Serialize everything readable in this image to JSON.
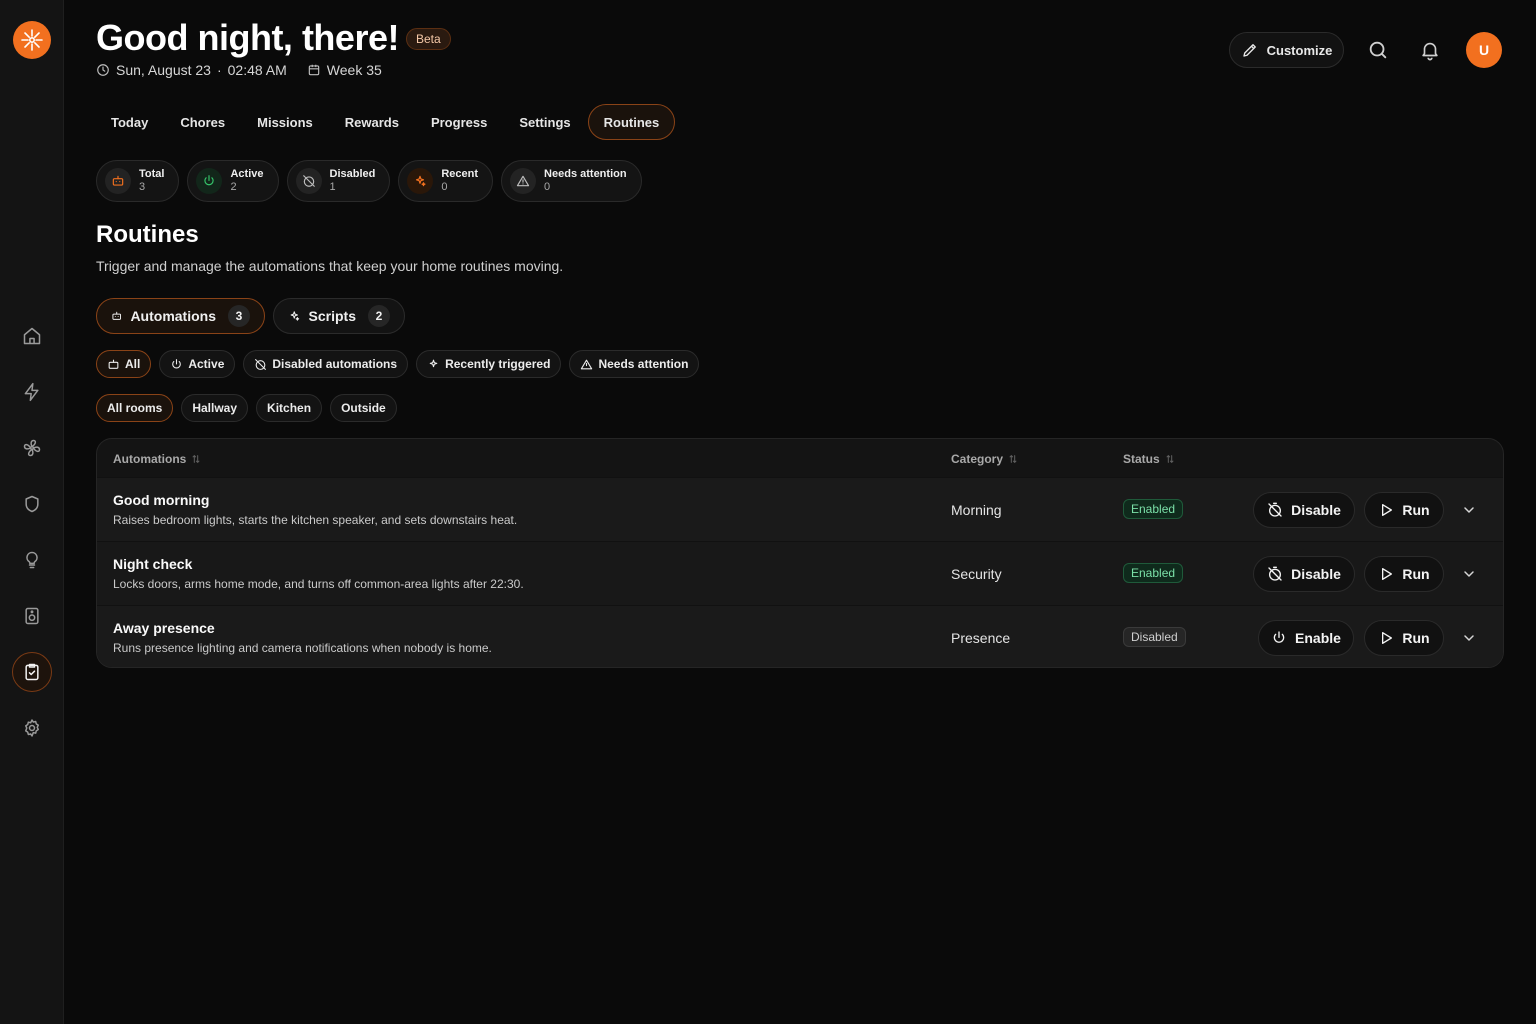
{
  "header": {
    "greeting": "Good night, there!",
    "badge": "Beta",
    "date": "Sun, August 23",
    "separator": "·",
    "time": "02:48 AM",
    "week": "Week 35",
    "customize_label": "Customize",
    "avatar_initial": "U"
  },
  "tabs": [
    "Today",
    "Chores",
    "Missions",
    "Rewards",
    "Progress",
    "Settings",
    "Routines"
  ],
  "stats": [
    {
      "label": "Total",
      "value": "3",
      "icon": "robot-icon",
      "color": "#f2701f"
    },
    {
      "label": "Active",
      "value": "2",
      "icon": "power-icon",
      "color": "#35c46a"
    },
    {
      "label": "Disabled",
      "value": "1",
      "icon": "timer-off-icon",
      "color": "#bdbdbd"
    },
    {
      "label": "Recent",
      "value": "0",
      "icon": "sparkles-icon",
      "color": "#f2701f"
    },
    {
      "label": "Needs attention",
      "value": "0",
      "icon": "warning-icon",
      "color": "#bdbdbd"
    }
  ],
  "section": {
    "title": "Routines",
    "description": "Trigger and manage the automations that keep your home routines moving."
  },
  "segments": [
    {
      "label": "Automations",
      "count": "3"
    },
    {
      "label": "Scripts",
      "count": "2"
    }
  ],
  "filters": [
    "All",
    "Active",
    "Disabled automations",
    "Recently triggered",
    "Needs attention"
  ],
  "rooms": [
    "All rooms",
    "Hallway",
    "Kitchen",
    "Outside"
  ],
  "table": {
    "columns": [
      "Automations",
      "Category",
      "Status"
    ],
    "rows": [
      {
        "name": "Good morning",
        "desc": "Raises bedroom lights, starts the kitchen speaker, and sets downstairs heat.",
        "category": "Morning",
        "status": "Enabled",
        "toggle": "Disable",
        "run": "Run"
      },
      {
        "name": "Night check",
        "desc": "Locks doors, arms home mode, and turns off common-area lights after 22:30.",
        "category": "Security",
        "status": "Enabled",
        "toggle": "Disable",
        "run": "Run"
      },
      {
        "name": "Away presence",
        "desc": "Runs presence lighting and camera notifications when nobody is home.",
        "category": "Presence",
        "status": "Disabled",
        "toggle": "Enable",
        "run": "Run"
      }
    ]
  },
  "colors": {
    "accent": "#f2701f",
    "background": "#0a0a0a",
    "sidebar": "#141414"
  }
}
